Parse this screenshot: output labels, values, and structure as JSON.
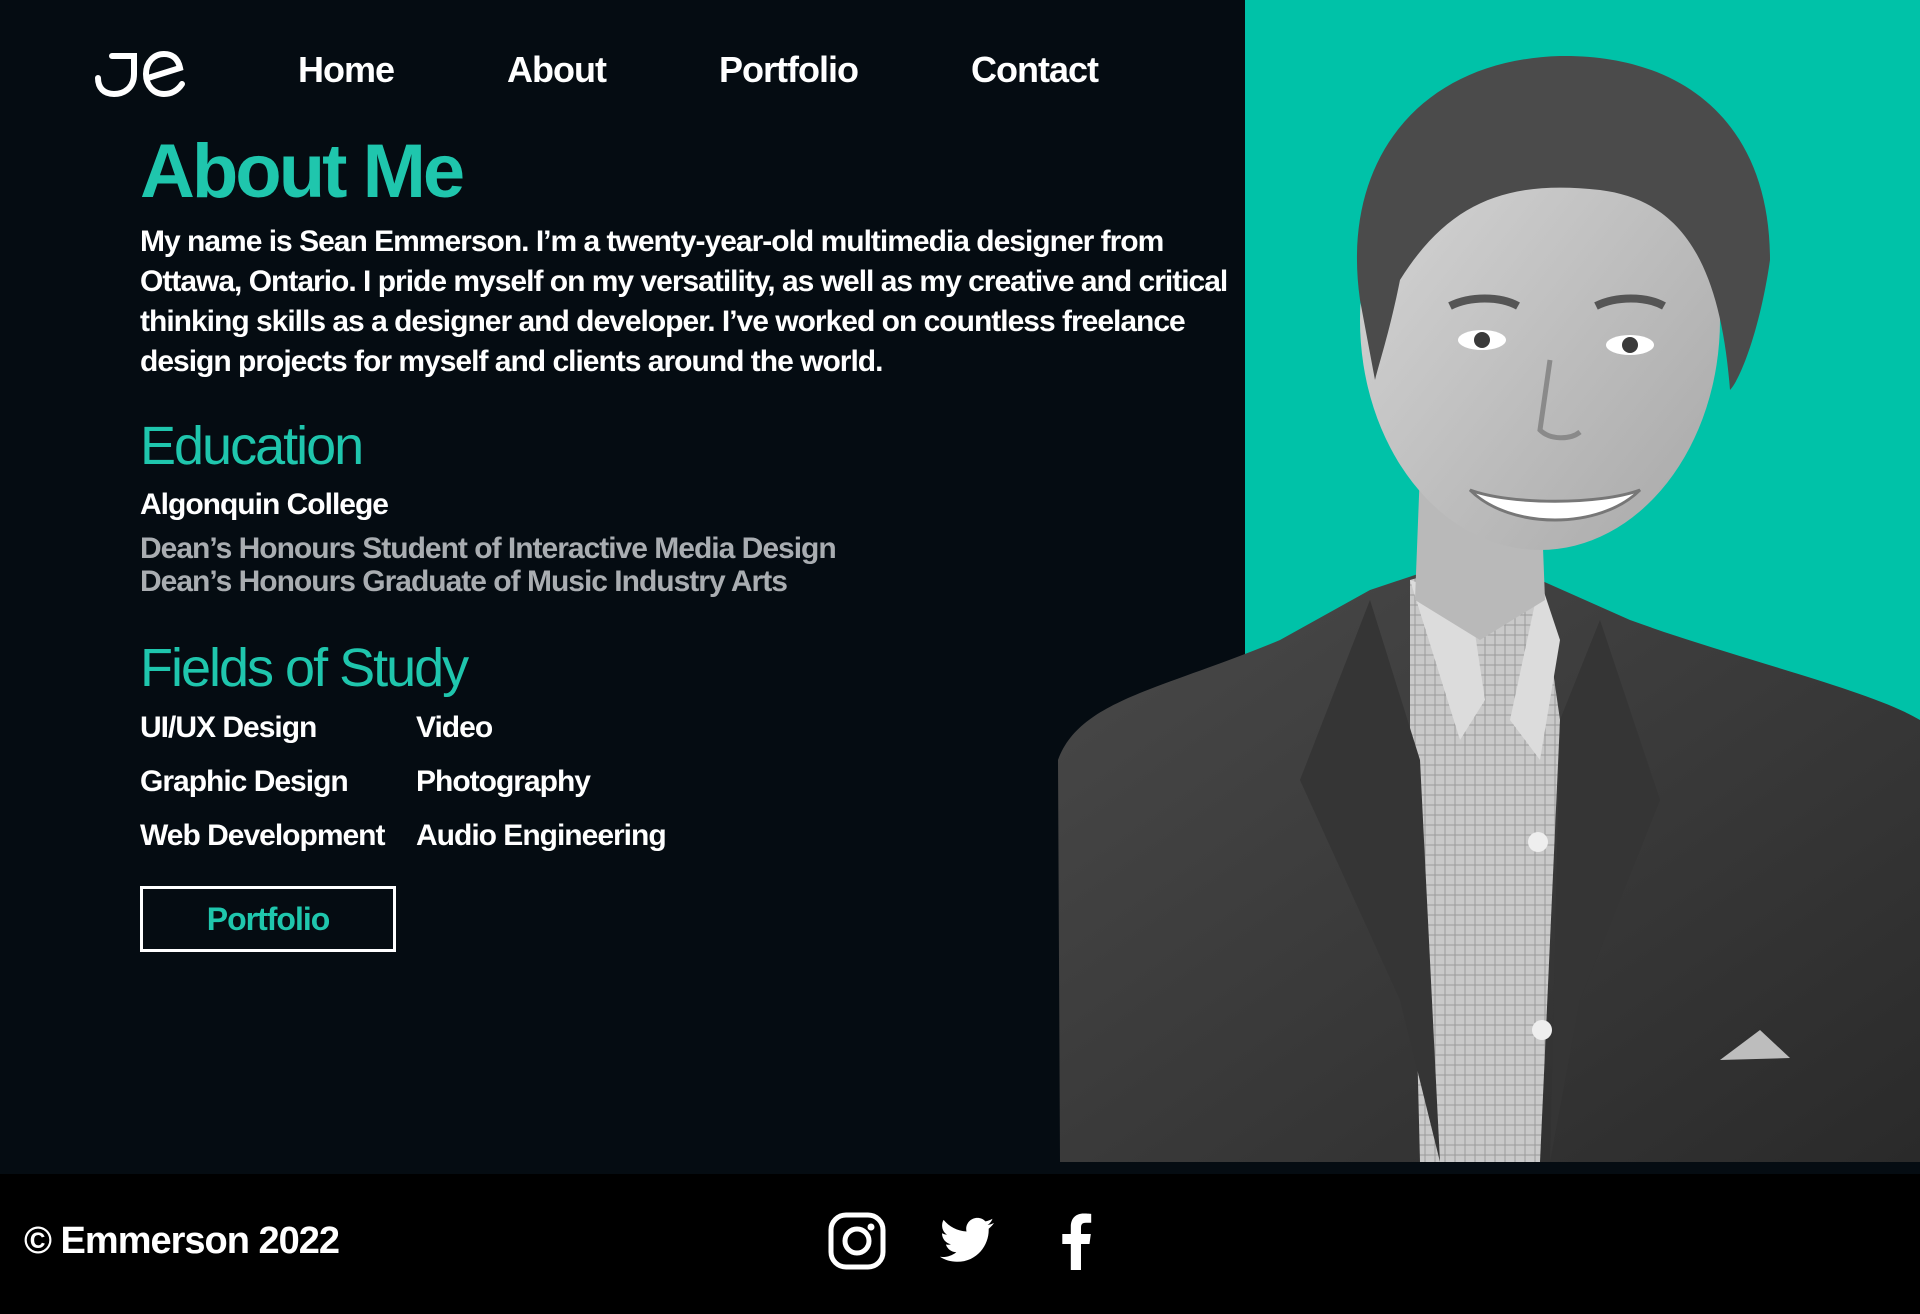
{
  "brand": {
    "logo_icon": "je-monogram-logo"
  },
  "nav": {
    "items": [
      {
        "label": "Home"
      },
      {
        "label": "About"
      },
      {
        "label": "Portfolio"
      },
      {
        "label": "Contact"
      }
    ]
  },
  "about": {
    "heading": "About Me",
    "text": "My name is Sean Emmerson. I’m a twenty-year-old multimedia designer from Ottawa, Ontario. I pride myself on my versatility, as well as my creative and critical thinking skills as a designer and developer.  I’ve worked on countless freelance design projects for myself and clients around the world."
  },
  "education": {
    "heading": "Education",
    "school": "Algonquin College",
    "honours": [
      "Dean’s Honours Student of Interactive Media Design",
      "Dean’s Honours Graduate of Music Industry Arts"
    ]
  },
  "fields": {
    "heading": "Fields of Study",
    "items": [
      "UI/UX Design",
      "Video",
      "Graphic Design",
      "Photography",
      "Web Development",
      "Audio Engineering"
    ]
  },
  "cta": {
    "label": "Portfolio"
  },
  "portrait": {
    "icon": "portrait-photo",
    "accent_color": "#00c2a8"
  },
  "footer": {
    "copyright": "© Emmerson 2022",
    "social": [
      {
        "icon": "instagram-icon"
      },
      {
        "icon": "twitter-icon"
      },
      {
        "icon": "facebook-icon"
      }
    ]
  },
  "colors": {
    "background": "#050c12",
    "accent": "#1fc6ad",
    "muted_text": "#a9adb1",
    "footer": "#000000"
  }
}
